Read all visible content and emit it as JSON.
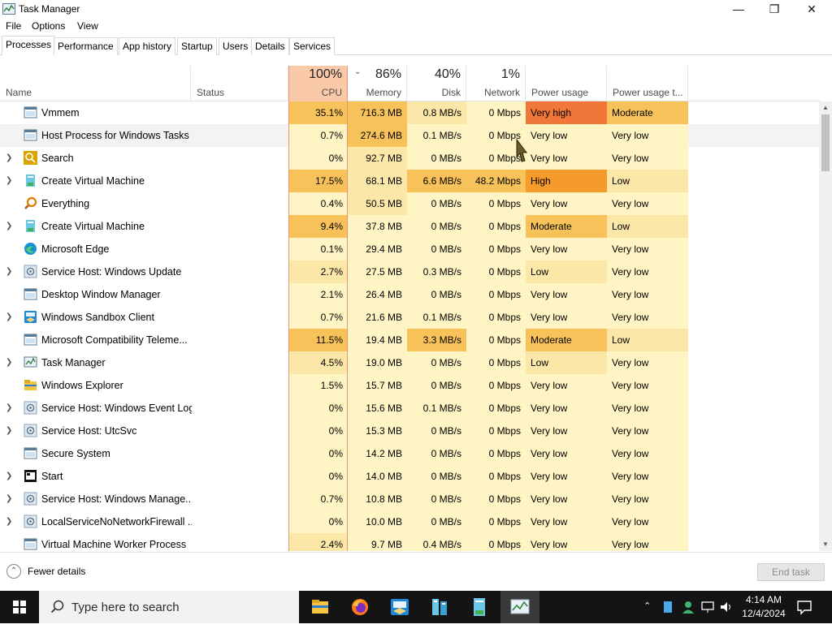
{
  "window": {
    "title": "Task Manager",
    "minimize": "—",
    "maximize": "❐",
    "close": "✕"
  },
  "menu": [
    "File",
    "Options",
    "View"
  ],
  "tabs": [
    "Processes",
    "Performance",
    "App history",
    "Startup",
    "Users",
    "Details",
    "Services"
  ],
  "active_tab": "Processes",
  "columns": {
    "name": "Name",
    "status": "Status",
    "cpu": {
      "pct": "100%",
      "label": "CPU"
    },
    "memory": {
      "pct": "86%",
      "label": "Memory"
    },
    "disk": {
      "pct": "40%",
      "label": "Disk"
    },
    "network": {
      "pct": "1%",
      "label": "Network"
    },
    "power": "Power usage",
    "power_trend": "Power usage t..."
  },
  "processes": [
    {
      "name": "Vmmem",
      "expand": false,
      "icon": "window-icon",
      "cpu": "35.1%",
      "mem": "716.3 MB",
      "disk": "0.8 MB/s",
      "net": "0 Mbps",
      "power": "Very high",
      "trend": "Moderate"
    },
    {
      "name": "Host Process for Windows Tasks",
      "expand": false,
      "icon": "window-icon",
      "cpu": "0.7%",
      "mem": "274.6 MB",
      "disk": "0.1 MB/s",
      "net": "0 Mbps",
      "power": "Very low",
      "trend": "Very low"
    },
    {
      "name": "Search",
      "expand": true,
      "icon": "search-icon",
      "cpu": "0%",
      "mem": "92.7 MB",
      "disk": "0 MB/s",
      "net": "0 Mbps",
      "power": "Very low",
      "trend": "Very low"
    },
    {
      "name": "Create Virtual Machine",
      "expand": true,
      "icon": "vm-icon",
      "cpu": "17.5%",
      "mem": "68.1 MB",
      "disk": "6.6 MB/s",
      "net": "48.2 Mbps",
      "power": "High",
      "trend": "Low"
    },
    {
      "name": "Everything",
      "expand": false,
      "icon": "magnifier-orange-icon",
      "cpu": "0.4%",
      "mem": "50.5 MB",
      "disk": "0 MB/s",
      "net": "0 Mbps",
      "power": "Very low",
      "trend": "Very low"
    },
    {
      "name": "Create Virtual Machine",
      "expand": true,
      "icon": "vm-icon",
      "cpu": "9.4%",
      "mem": "37.8 MB",
      "disk": "0 MB/s",
      "net": "0 Mbps",
      "power": "Moderate",
      "trend": "Low"
    },
    {
      "name": "Microsoft Edge",
      "expand": false,
      "icon": "edge-icon",
      "cpu": "0.1%",
      "mem": "29.4 MB",
      "disk": "0 MB/s",
      "net": "0 Mbps",
      "power": "Very low",
      "trend": "Very low"
    },
    {
      "name": "Service Host: Windows Update",
      "expand": true,
      "icon": "gear-icon",
      "cpu": "2.7%",
      "mem": "27.5 MB",
      "disk": "0.3 MB/s",
      "net": "0 Mbps",
      "power": "Low",
      "trend": "Very low"
    },
    {
      "name": "Desktop Window Manager",
      "expand": false,
      "icon": "window-icon",
      "cpu": "2.1%",
      "mem": "26.4 MB",
      "disk": "0 MB/s",
      "net": "0 Mbps",
      "power": "Very low",
      "trend": "Very low"
    },
    {
      "name": "Windows Sandbox Client",
      "expand": true,
      "icon": "sandbox-icon",
      "cpu": "0.7%",
      "mem": "21.6 MB",
      "disk": "0.1 MB/s",
      "net": "0 Mbps",
      "power": "Very low",
      "trend": "Very low"
    },
    {
      "name": "Microsoft Compatibility Teleme...",
      "expand": false,
      "icon": "window-icon",
      "cpu": "11.5%",
      "mem": "19.4 MB",
      "disk": "3.3 MB/s",
      "net": "0 Mbps",
      "power": "Moderate",
      "trend": "Low"
    },
    {
      "name": "Task Manager",
      "expand": true,
      "icon": "task-manager-icon",
      "cpu": "4.5%",
      "mem": "19.0 MB",
      "disk": "0 MB/s",
      "net": "0 Mbps",
      "power": "Low",
      "trend": "Very low"
    },
    {
      "name": "Windows Explorer",
      "expand": false,
      "icon": "folder-icon",
      "cpu": "1.5%",
      "mem": "15.7 MB",
      "disk": "0 MB/s",
      "net": "0 Mbps",
      "power": "Very low",
      "trend": "Very low"
    },
    {
      "name": "Service Host: Windows Event Log",
      "expand": true,
      "icon": "gear-icon",
      "cpu": "0%",
      "mem": "15.6 MB",
      "disk": "0.1 MB/s",
      "net": "0 Mbps",
      "power": "Very low",
      "trend": "Very low"
    },
    {
      "name": "Service Host: UtcSvc",
      "expand": true,
      "icon": "gear-icon",
      "cpu": "0%",
      "mem": "15.3 MB",
      "disk": "0 MB/s",
      "net": "0 Mbps",
      "power": "Very low",
      "trend": "Very low"
    },
    {
      "name": "Secure System",
      "expand": false,
      "icon": "window-icon",
      "cpu": "0%",
      "mem": "14.2 MB",
      "disk": "0 MB/s",
      "net": "0 Mbps",
      "power": "Very low",
      "trend": "Very low"
    },
    {
      "name": "Start",
      "expand": true,
      "icon": "start-app-icon",
      "cpu": "0%",
      "mem": "14.0 MB",
      "disk": "0 MB/s",
      "net": "0 Mbps",
      "power": "Very low",
      "trend": "Very low"
    },
    {
      "name": "Service Host: Windows Manage...",
      "expand": true,
      "icon": "gear-icon",
      "cpu": "0.7%",
      "mem": "10.8 MB",
      "disk": "0 MB/s",
      "net": "0 Mbps",
      "power": "Very low",
      "trend": "Very low"
    },
    {
      "name": "LocalServiceNoNetworkFirewall ...",
      "expand": true,
      "icon": "gear-icon",
      "cpu": "0%",
      "mem": "10.0 MB",
      "disk": "0 MB/s",
      "net": "0 Mbps",
      "power": "Very low",
      "trend": "Very low"
    },
    {
      "name": "Virtual Machine Worker Process",
      "expand": false,
      "icon": "window-icon",
      "cpu": "2.4%",
      "mem": "9.7 MB",
      "disk": "0.4 MB/s",
      "net": "0 Mbps",
      "power": "Very low",
      "trend": "Very low"
    }
  ],
  "footer": {
    "fewer_details": "Fewer details",
    "end_task": "End task"
  },
  "taskbar": {
    "search_placeholder": "Type here to search",
    "time": "4:14 AM",
    "date": "12/4/2024",
    "pinned": [
      "file-explorer-icon",
      "firefox-icon",
      "sandbox-icon",
      "vm-create-icon",
      "vm-create-icon-2",
      "task-manager-icon"
    ]
  },
  "colors": {
    "cpu_header": "#f9c9a8",
    "very_high": "#f0763a",
    "high": "#f59b2b",
    "moderate": "#f8c25a",
    "low_cell": "#fbe8a8",
    "very_low_cell": "#fff4c4",
    "taskbar": "#141414"
  }
}
